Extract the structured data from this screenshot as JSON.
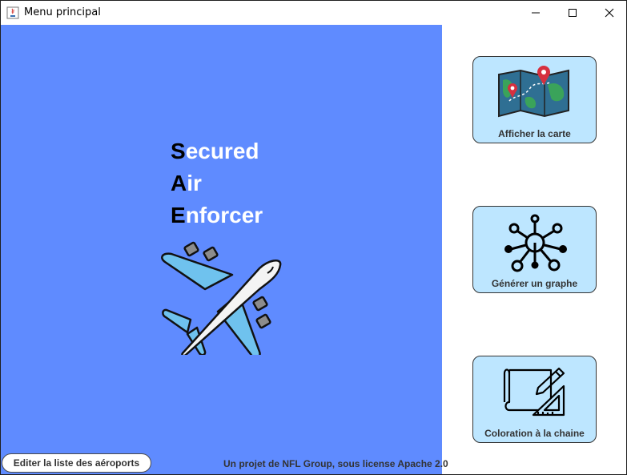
{
  "window": {
    "title": "Menu principal"
  },
  "brand": {
    "lines": [
      {
        "initial": "S",
        "rest": "ecured"
      },
      {
        "initial": "A",
        "rest": "ir"
      },
      {
        "initial": "E",
        "rest": "nforcer"
      }
    ]
  },
  "actions": {
    "map_label": "Afficher la carte",
    "graph_label": "Générer un graphe",
    "coloring_label": "Coloration à la chaine"
  },
  "bottom": {
    "edit_label": "Editer la liste des aéroports",
    "footer_text": "Un projet de NFL Group, sous license Apache 2.0"
  },
  "colors": {
    "panel_bg": "#5f8bff",
    "button_bg": "#bde6ff"
  },
  "icons": [
    "java-app-icon",
    "minimize-icon",
    "maximize-icon",
    "close-icon",
    "airplane-icon",
    "map-icon",
    "graph-icon",
    "blueprint-icon"
  ]
}
